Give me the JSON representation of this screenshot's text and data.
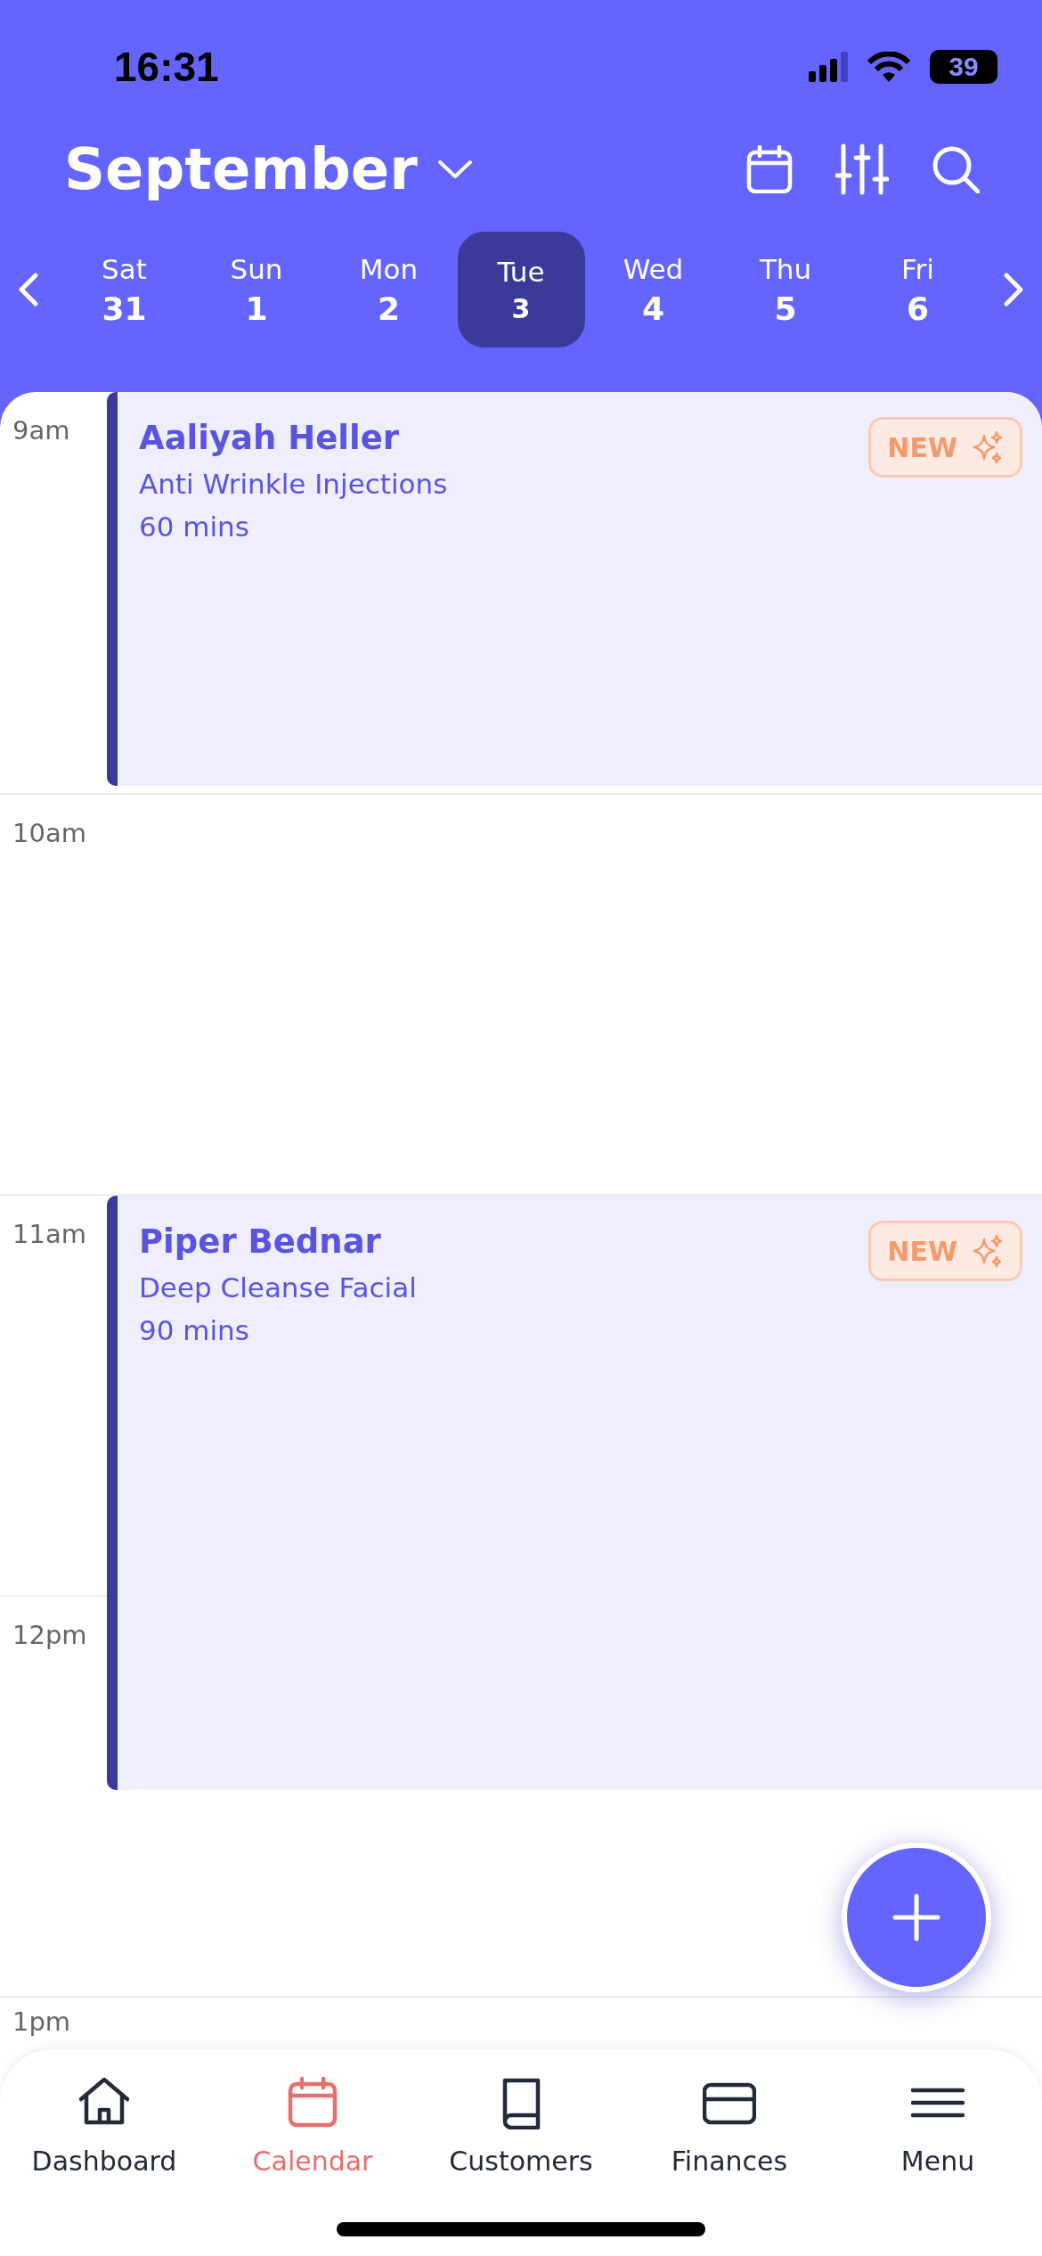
{
  "status_bar": {
    "time": "16:31",
    "battery": "39"
  },
  "header": {
    "month": "September"
  },
  "days": [
    {
      "weekday": "Sat",
      "date": "31",
      "selected": false
    },
    {
      "weekday": "Sun",
      "date": "1",
      "selected": false
    },
    {
      "weekday": "Mon",
      "date": "2",
      "selected": false
    },
    {
      "weekday": "Tue",
      "date": "3",
      "selected": true
    },
    {
      "weekday": "Wed",
      "date": "4",
      "selected": false
    },
    {
      "weekday": "Thu",
      "date": "5",
      "selected": false
    },
    {
      "weekday": "Fri",
      "date": "6",
      "selected": false
    }
  ],
  "hours": [
    {
      "label": "9am",
      "appointments": [
        {
          "name": "Aaliyah Heller",
          "service": "Anti Wrinkle Injections",
          "duration": "60 mins",
          "badge": "NEW"
        }
      ]
    },
    {
      "label": "10am"
    },
    {
      "label": "11am",
      "appointments": [
        {
          "name": "Piper Bednar",
          "service": "Deep Cleanse Facial",
          "duration": "90 mins",
          "badge": "NEW"
        }
      ]
    },
    {
      "label": "12pm"
    },
    {
      "label": "1pm"
    }
  ],
  "nav": [
    {
      "kind": "home",
      "label": "Dashboard",
      "selected": false
    },
    {
      "kind": "calendar",
      "label": "Calendar",
      "selected": true
    },
    {
      "kind": "book",
      "label": "Customers",
      "selected": false
    },
    {
      "kind": "card",
      "label": "Finances",
      "selected": false
    },
    {
      "kind": "menu",
      "label": "Menu",
      "selected": false
    }
  ]
}
